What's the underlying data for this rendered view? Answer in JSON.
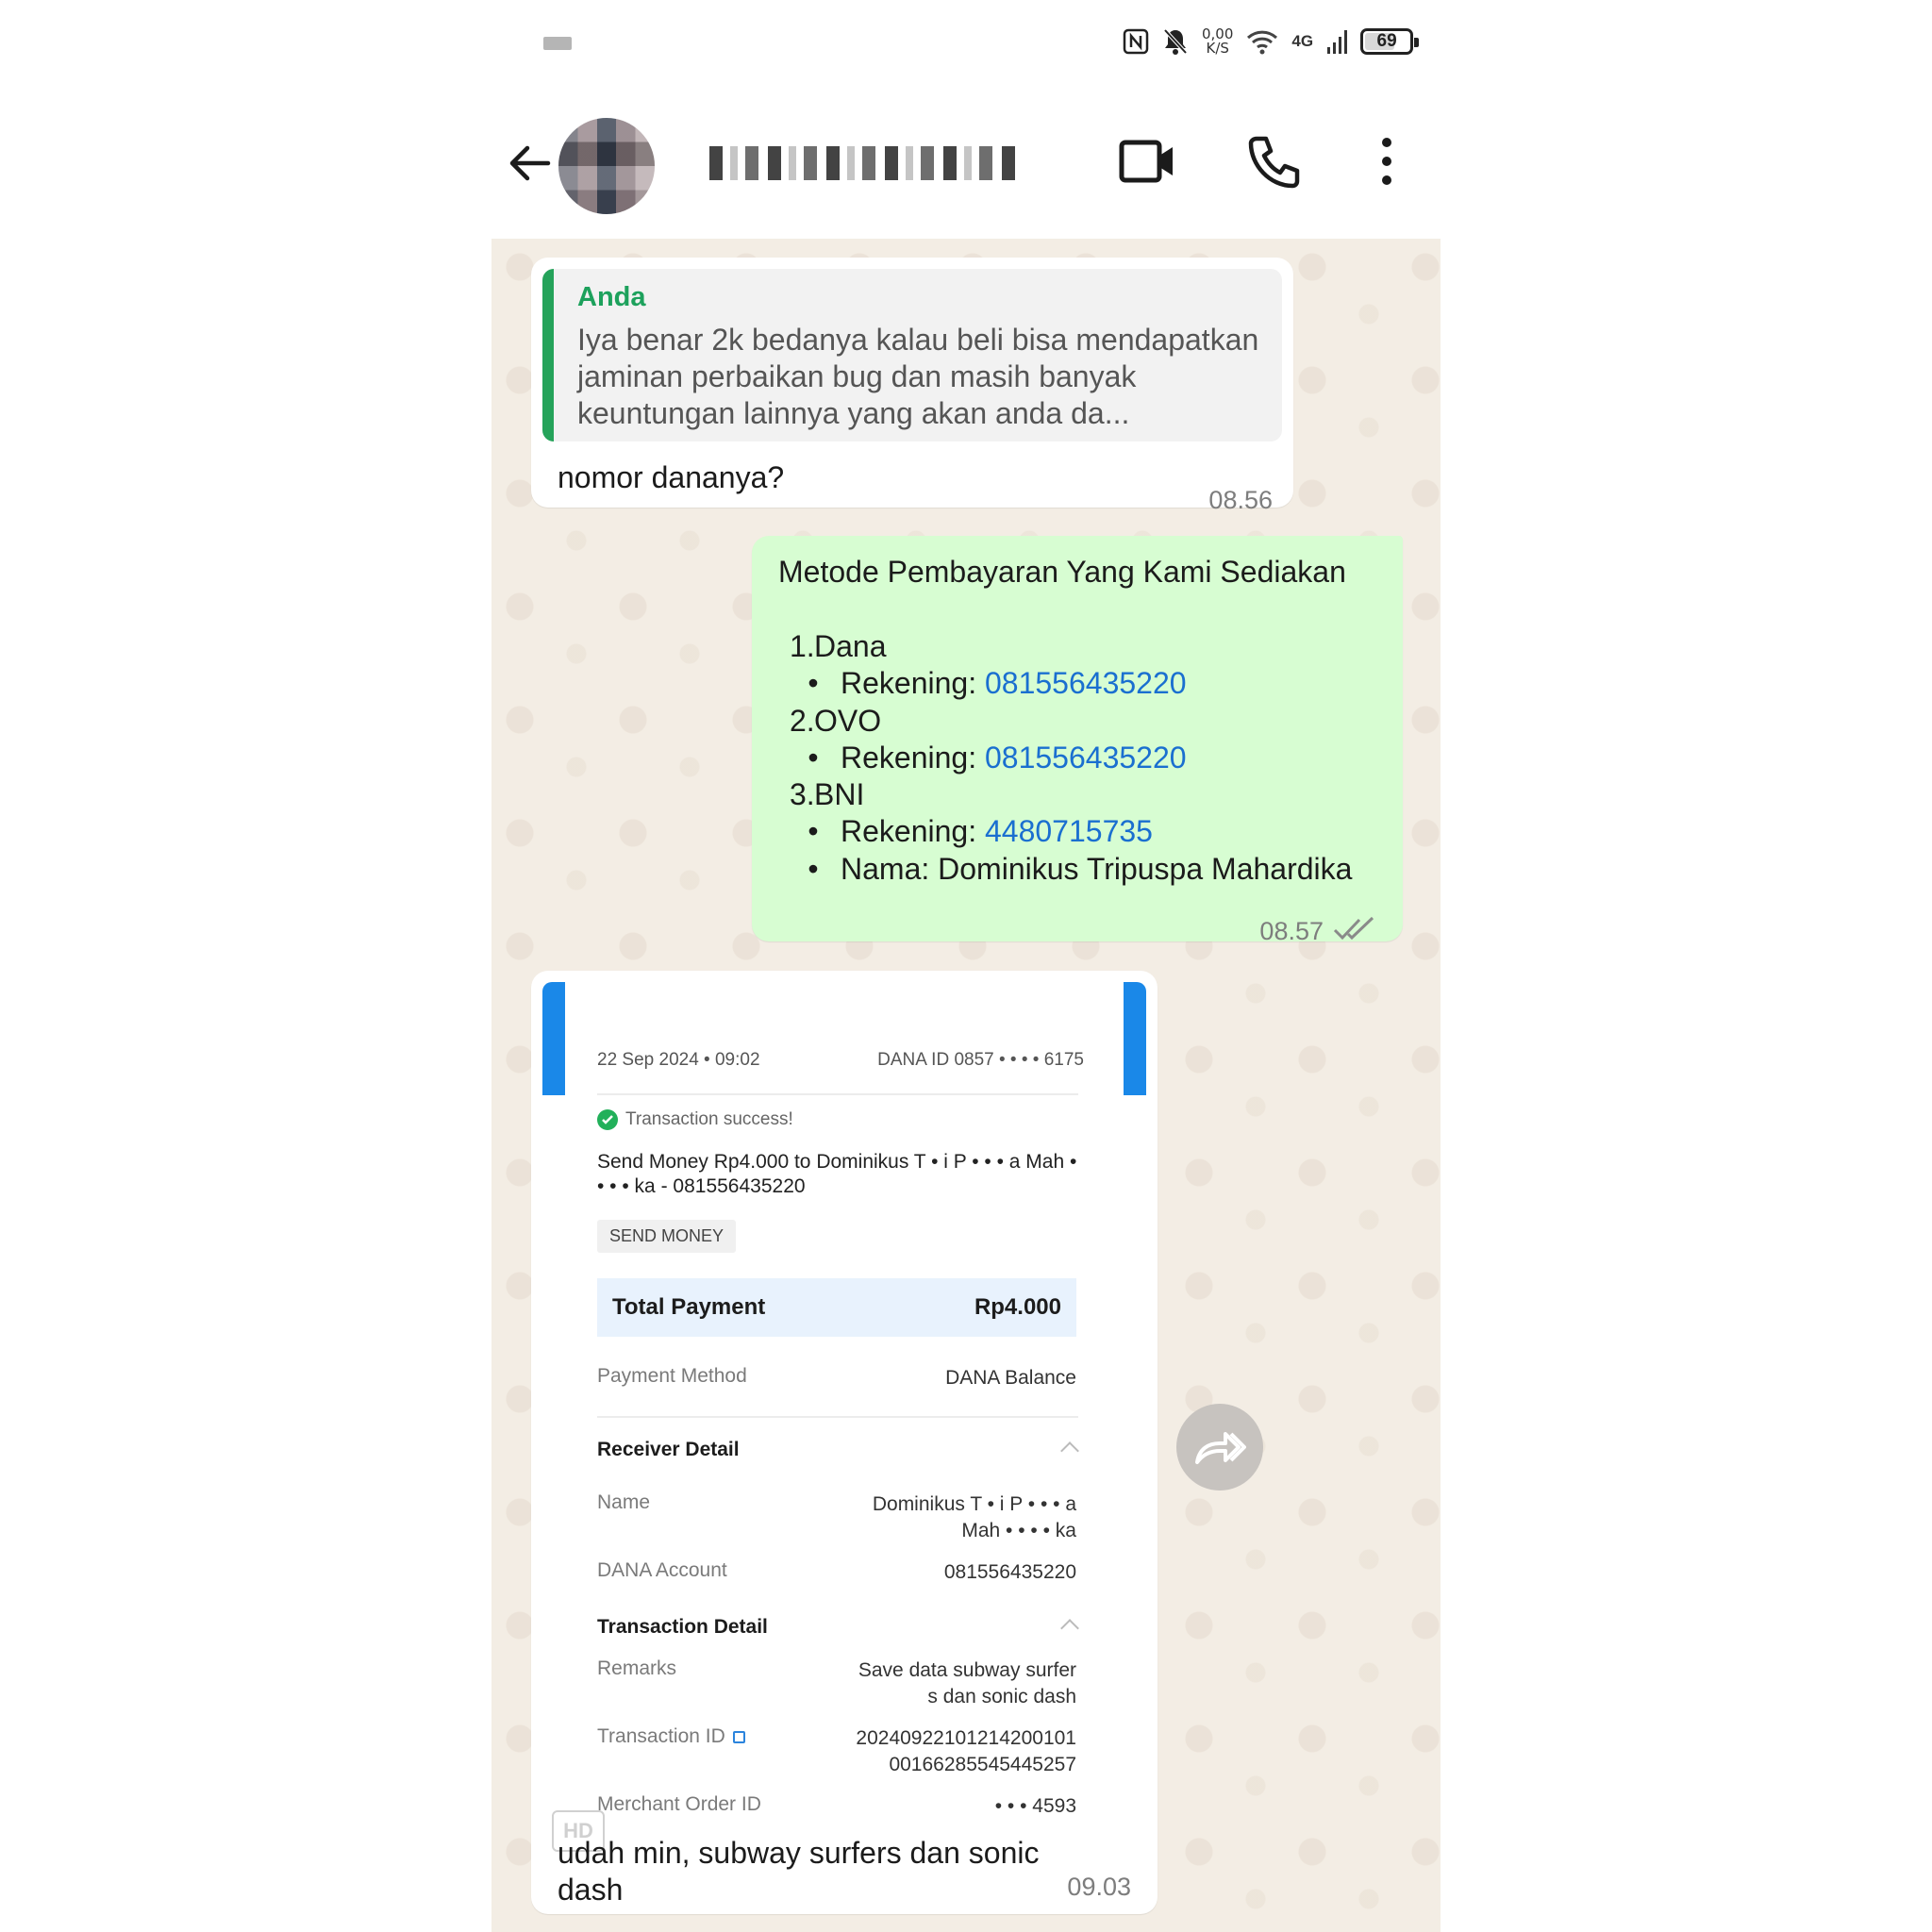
{
  "status_bar": {
    "speed_value": "0,00",
    "speed_unit": "K/S",
    "network": "4G",
    "battery": "69",
    "battery_level": 0.69
  },
  "header": {
    "icons": [
      "back-arrow-icon",
      "video-call-icon",
      "phone-icon",
      "more-vert-icon"
    ]
  },
  "messages": {
    "m1": {
      "quote_author": "Anda",
      "quote_text": "Iya benar 2k bedanya kalau beli bisa mendapatkan jaminan perbaikan bug dan masih banyak keuntungan lainnya yang akan anda da...",
      "text": "nomor dananya?",
      "time": "08.56"
    },
    "m2": {
      "title": "Metode Pembayaran Yang Kami Sediakan",
      "items": [
        {
          "marker": "1.",
          "label": "Dana",
          "link": ""
        },
        {
          "marker": "•",
          "label": "Rekening: ",
          "link": "081556435220"
        },
        {
          "marker": "2.",
          "label": "OVO",
          "link": ""
        },
        {
          "marker": "•",
          "label": "Rekening: ",
          "link": "081556435220"
        },
        {
          "marker": "3.",
          "label": "BNI",
          "link": ""
        },
        {
          "marker": "•",
          "label": "Rekening: ",
          "link": "4480715735"
        },
        {
          "marker": "•",
          "label": "Nama: Dominikus Tripuspa Mahardika",
          "link": ""
        }
      ],
      "time": "08.57"
    },
    "m3": {
      "receipt": {
        "date": "22 Sep 2024  •  09:02",
        "dana_id": "DANA ID 0857 • • • • 6175",
        "status": "Transaction success!",
        "description": "Send Money Rp4.000 to Dominikus T • i P • • • a Mah • • • • ka - 081556435220",
        "tag": "SEND MONEY",
        "total_label": "Total Payment",
        "total_value": "Rp4.000",
        "payment_method_label": "Payment Method",
        "payment_method_value": "DANA Balance",
        "receiver_section": "Receiver Detail",
        "name_label": "Name",
        "name_value_1": "Dominikus T • i P • • • a",
        "name_value_2": "Mah • • • • ka",
        "account_label": "DANA Account",
        "account_value": "081556435220",
        "transaction_section": "Transaction Detail",
        "remarks_label": "Remarks",
        "remarks_value_1": "Save data subway surfer",
        "remarks_value_2": "s dan sonic dash",
        "txid_label": "Transaction ID",
        "txid_value_1": "2024092210121420010​1",
        "txid_value_2": "001662855454452​57",
        "merchant_label": "Merchant Order ID",
        "merchant_value": "• • • 4593",
        "hd_badge": "HD"
      },
      "caption": "udah min, subway surfers dan sonic dash",
      "time": "09.03"
    }
  }
}
